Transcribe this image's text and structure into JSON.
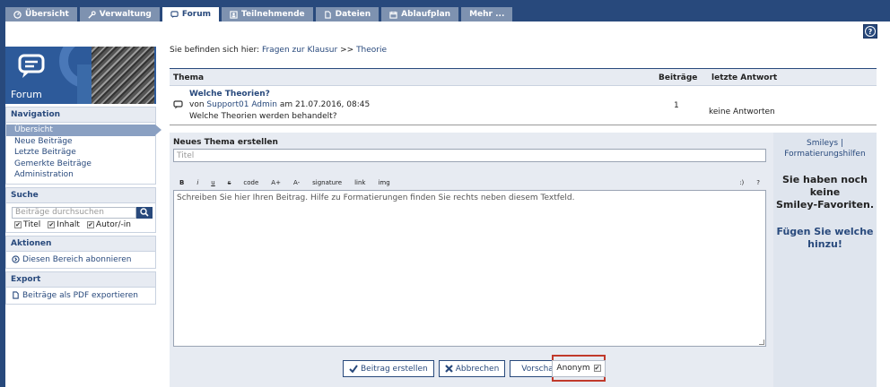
{
  "tabs": [
    {
      "label": "Übersicht",
      "icon": "dashboard-icon"
    },
    {
      "label": "Verwaltung",
      "icon": "wrench-icon"
    },
    {
      "label": "Forum",
      "icon": "chat-bubble-icon"
    },
    {
      "label": "Teilnehmende",
      "icon": "person-card-icon"
    },
    {
      "label": "Dateien",
      "icon": "files-icon"
    },
    {
      "label": "Ablaufplan",
      "icon": "calendar-icon"
    },
    {
      "label": "Mehr ...",
      "icon": ""
    }
  ],
  "help_label": "?",
  "sidebar": {
    "forum_title": "Forum",
    "navigation": {
      "heading": "Navigation",
      "items": [
        "Übersicht",
        "Neue Beiträge",
        "Letzte Beiträge",
        "Gemerkte Beiträge",
        "Administration"
      ]
    },
    "search": {
      "heading": "Suche",
      "placeholder": "Beiträge durchsuchen",
      "options": [
        "Titel",
        "Inhalt",
        "Autor/-in"
      ]
    },
    "actions": {
      "heading": "Aktionen",
      "item": "Diesen Bereich abonnieren"
    },
    "export": {
      "heading": "Export",
      "item": "Beiträge als PDF exportieren"
    }
  },
  "breadcrumb": {
    "prefix": "Sie befinden sich hier:",
    "part1": "Fragen zur Klausur",
    "sep": ">>",
    "part2": "Theorie"
  },
  "table": {
    "headers": {
      "topic": "Thema",
      "posts": "Beiträge",
      "last": "letzte Antwort"
    },
    "rows": [
      {
        "title": "Welche Theorien?",
        "by": "von",
        "author": "Support01 Admin",
        "date": "am 21.07.2016, 08:45",
        "desc": "Welche Theorien werden behandelt?",
        "count": "1",
        "last": "keine Antworten"
      }
    ]
  },
  "editor": {
    "heading": "Neues Thema erstellen",
    "title_placeholder": "Titel",
    "toolbar": [
      "B",
      "i",
      "u",
      "s",
      "code",
      "A+",
      "A-",
      "signature",
      "link",
      "img"
    ],
    "toolbar_right": [
      ":)",
      "?"
    ],
    "body_placeholder": "Schreiben Sie hier Ihren Beitrag. Hilfe zu Formatierungen finden Sie rechts neben diesem Textfeld."
  },
  "smileys": {
    "link1": "Smileys |",
    "link2": "Formatierungshilfen",
    "empty1": "Sie haben noch keine",
    "empty2": "Smiley-Favoriten.",
    "add1": "Fügen Sie welche",
    "add2": "hinzu!"
  },
  "buttons": {
    "create": "Beitrag erstellen",
    "cancel": "Abbrechen",
    "preview": "Vorschau",
    "anon": "Anonym"
  },
  "colors": {
    "brand": "#28497c",
    "highlight": "#c0392b"
  }
}
